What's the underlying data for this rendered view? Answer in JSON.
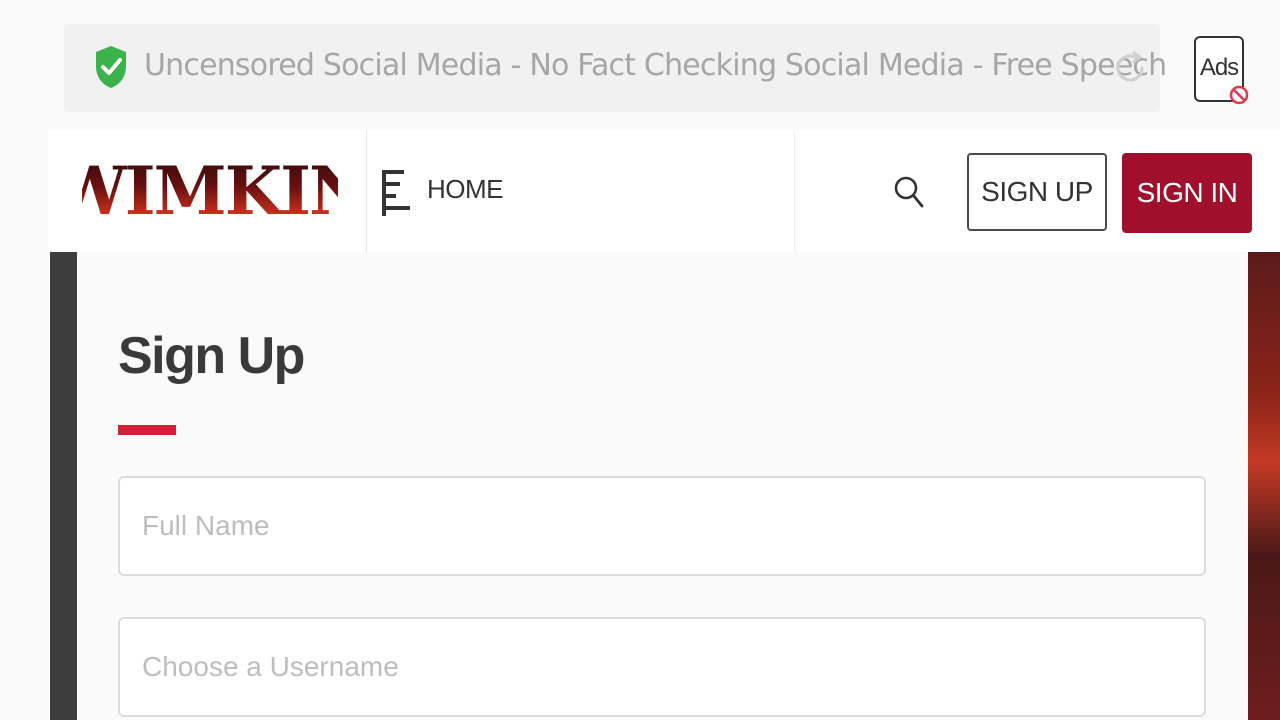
{
  "topbar": {
    "title": "Uncensored Social Media - No Fact Checking Social Media - Free Speech",
    "ads_label": "Ads"
  },
  "header": {
    "logo_text": "WIMKIN",
    "home_label": "HOME",
    "signup_label": "SIGN UP",
    "signin_label": "SIGN IN"
  },
  "form": {
    "heading": "Sign Up",
    "fullname_placeholder": "Full Name",
    "fullname_value": "",
    "username_placeholder": "Choose a Username",
    "username_value": ""
  },
  "icons": {
    "secure": "shield-check-icon",
    "reload": "reload-icon",
    "adblock": "ad-block-icon",
    "menu": "menu-icon",
    "search": "search-icon"
  },
  "colors": {
    "brand_red": "#a00f2c",
    "accent_red": "#d41f3a",
    "secure_green": "#3bb34a"
  }
}
